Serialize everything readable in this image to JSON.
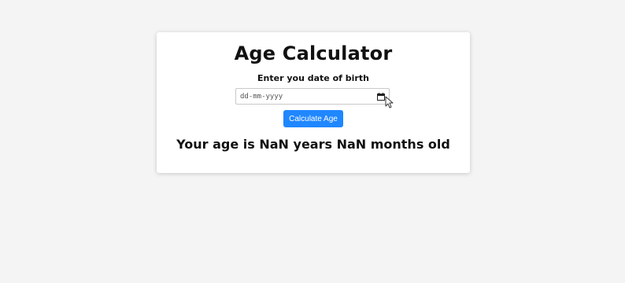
{
  "app": {
    "title": "Age Calculator"
  },
  "form": {
    "label": "Enter you date of birth",
    "date_placeholder": "dd-mm-yyyy",
    "calculate_label": "Calculate Age"
  },
  "result": {
    "text": "Your age is NaN years NaN months old"
  },
  "icons": {
    "calendar": "calendar-icon",
    "cursor": "mouse-pointer-icon"
  },
  "colors": {
    "accent": "#1f87ff",
    "background": "#f4f4f4",
    "card": "#ffffff",
    "text": "#111111"
  }
}
